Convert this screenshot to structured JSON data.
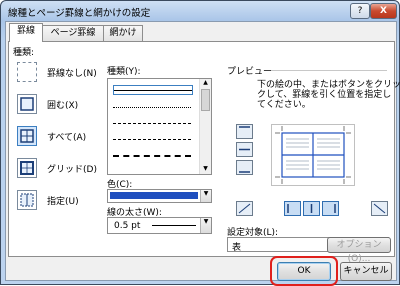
{
  "window": {
    "title": "線種とページ罫線と網かけの設定",
    "help_glyph": "?",
    "close_glyph": "X"
  },
  "tabs": [
    {
      "label": "罫線",
      "active": true
    },
    {
      "label": "ページ罫線",
      "active": false
    },
    {
      "label": "網かけ",
      "active": false
    }
  ],
  "setting": {
    "label": "種類:",
    "options": [
      {
        "label": "罫線なし(N)",
        "selected": false
      },
      {
        "label": "囲む(X)",
        "selected": false
      },
      {
        "label": "すべて(A)",
        "selected": true
      },
      {
        "label": "グリッド(D)",
        "selected": false
      },
      {
        "label": "指定(U)",
        "selected": false
      }
    ]
  },
  "style": {
    "label": "種類(Y):"
  },
  "color": {
    "label": "色(C):",
    "value": "",
    "swatch": "#1f4fbf"
  },
  "width": {
    "label": "線の太さ(W):",
    "value": "0.5 pt"
  },
  "preview": {
    "label": "プレビュー",
    "instruction_line1": "下の絵の中、またはボタンをクリッ",
    "instruction_line2": "クして、罫線を引く位置を指定し",
    "instruction_line3": "てください。"
  },
  "apply_to": {
    "label": "設定対象(L):",
    "value": "表"
  },
  "options_button": "オプション(O)...",
  "ok_button": "OK",
  "cancel_button": "キャンセル",
  "highlight_color": "#e0201c"
}
